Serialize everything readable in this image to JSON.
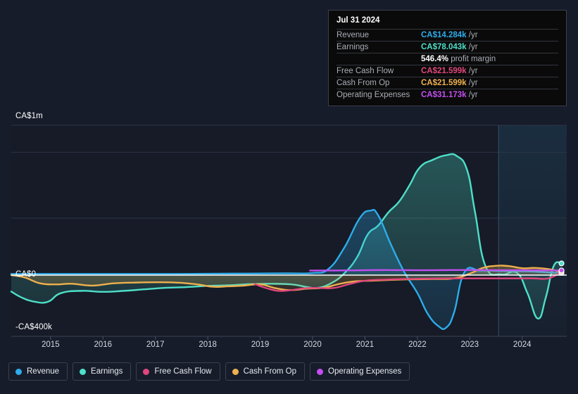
{
  "background_color": "#171c2a",
  "tooltip": {
    "date": "Jul 31 2024",
    "rows": [
      {
        "label": "Revenue",
        "value": "CA$14.284k",
        "unit": "/yr",
        "color": "#2dacea"
      },
      {
        "label": "Earnings",
        "value": "CA$78.043k",
        "unit": "/yr",
        "color": "#4edfc8"
      },
      {
        "label": "",
        "value": "546.4%",
        "unit": "profit margin",
        "color": "#ffffff",
        "is_margin": true
      },
      {
        "label": "Free Cash Flow",
        "value": "CA$21.599k",
        "unit": "/yr",
        "color": "#e0467c"
      },
      {
        "label": "Cash From Op",
        "value": "CA$21.599k",
        "unit": "/yr",
        "color": "#eeb04e"
      },
      {
        "label": "Operating Expenses",
        "value": "CA$31.173k",
        "unit": "/yr",
        "color": "#c24ef0"
      }
    ]
  },
  "legend": {
    "items": [
      {
        "label": "Revenue",
        "color": "#2dacea"
      },
      {
        "label": "Earnings",
        "color": "#4edfc8"
      },
      {
        "label": "Free Cash Flow",
        "color": "#e0467c"
      },
      {
        "label": "Cash From Op",
        "color": "#eeb04e"
      },
      {
        "label": "Operating Expenses",
        "color": "#c24ef0"
      }
    ]
  },
  "chart_data": {
    "type": "line",
    "title": "",
    "xlabel": "",
    "ylabel": "",
    "currency": "CA$",
    "grid": true,
    "legend_position": "bottom",
    "y_axis": {
      "labels": [
        "CA$1m",
        "CA$0",
        "-CA$400k"
      ],
      "values": [
        1000000,
        0,
        -400000
      ],
      "ylim": [
        -400000,
        1000000
      ],
      "gridlines": [
        1000000,
        820000,
        380000,
        0
      ]
    },
    "x_axis": {
      "tick_labels": [
        "2015",
        "2016",
        "2017",
        "2018",
        "2019",
        "2020",
        "2021",
        "2022",
        "2023",
        "2024"
      ],
      "tick_values": [
        2015,
        2016,
        2017,
        2018,
        2019,
        2020,
        2021,
        2022,
        2023,
        2024
      ],
      "xlim": [
        2014.25,
        2024.85
      ]
    },
    "forecast_band": {
      "start": 2023.55,
      "end": 2024.85,
      "label": ""
    },
    "series": [
      {
        "name": "Revenue",
        "color": "#2dacea",
        "x": [
          2014.25,
          2014.6,
          2015.0,
          2015.5,
          2016.0,
          2016.5,
          2017.0,
          2017.5,
          2018.0,
          2018.5,
          2019.0,
          2019.5,
          2020.0,
          2020.3,
          2020.6,
          2020.9,
          2021.1,
          2021.25,
          2021.5,
          2021.75,
          2022.0,
          2022.2,
          2022.4,
          2022.55,
          2022.7,
          2022.9,
          2023.2,
          2023.55,
          2023.9,
          2024.2,
          2024.5,
          2024.75
        ],
        "values": [
          8000,
          8000,
          8000,
          8000,
          8000,
          8000,
          8000,
          8000,
          9000,
          10000,
          11000,
          12000,
          14000,
          40000,
          180000,
          380000,
          430000,
          400000,
          200000,
          20000,
          -120000,
          -260000,
          -340000,
          -350000,
          -250000,
          20000,
          30000,
          28000,
          26000,
          24000,
          18000,
          14284
        ]
      },
      {
        "name": "Earnings",
        "color": "#4edfc8",
        "x": [
          2014.25,
          2014.45,
          2014.7,
          2014.95,
          2015.2,
          2015.6,
          2016.0,
          2016.4,
          2016.8,
          2017.2,
          2017.6,
          2018.0,
          2018.4,
          2018.8,
          2019.2,
          2019.6,
          2019.9,
          2020.1,
          2020.35,
          2020.6,
          2020.85,
          2021.05,
          2021.25,
          2021.45,
          2021.65,
          2021.85,
          2022.05,
          2022.3,
          2022.55,
          2022.75,
          2022.95,
          2023.1,
          2023.3,
          2023.6,
          2023.9,
          2024.1,
          2024.3,
          2024.45,
          2024.6,
          2024.75
        ],
        "values": [
          -110000,
          -150000,
          -178000,
          -178000,
          -120000,
          -105000,
          -112000,
          -105000,
          -95000,
          -85000,
          -80000,
          -72000,
          -68000,
          -60000,
          -58000,
          -62000,
          -80000,
          -85000,
          -55000,
          10000,
          120000,
          270000,
          330000,
          420000,
          490000,
          600000,
          720000,
          770000,
          800000,
          795000,
          700000,
          420000,
          60000,
          5000,
          15000,
          -120000,
          -290000,
          -150000,
          60000,
          78043
        ]
      },
      {
        "name": "Free Cash Flow",
        "color": "#e0467c",
        "x": [
          2018.9,
          2019.1,
          2019.35,
          2019.6,
          2019.85,
          2020.1,
          2020.4,
          2020.7,
          2021.0,
          2021.4,
          2021.8,
          2022.2,
          2022.6,
          2023.0,
          2023.4,
          2023.8,
          2024.2,
          2024.5,
          2024.75
        ],
        "values": [
          -60000,
          -85000,
          -105000,
          -100000,
          -88000,
          -86000,
          -86000,
          -60000,
          -38000,
          -30000,
          -26000,
          -24000,
          -22000,
          -22000,
          -22000,
          -21800,
          -21700,
          -21650,
          21599
        ]
      },
      {
        "name": "Cash From Op",
        "color": "#eeb04e",
        "x": [
          2014.25,
          2014.5,
          2014.8,
          2015.1,
          2015.4,
          2015.8,
          2016.2,
          2016.6,
          2017.0,
          2017.4,
          2017.8,
          2018.1,
          2018.4,
          2018.7,
          2019.0,
          2019.3,
          2019.6,
          2019.9,
          2020.2,
          2020.5,
          2020.8,
          2021.1,
          2021.5,
          2021.9,
          2022.3,
          2022.7,
          2023.0,
          2023.25,
          2023.5,
          2023.75,
          2024.0,
          2024.25,
          2024.5,
          2024.75
        ],
        "values": [
          0,
          -15000,
          -55000,
          -62000,
          -58000,
          -70000,
          -55000,
          -50000,
          -48000,
          -50000,
          -62000,
          -78000,
          -75000,
          -70000,
          -62000,
          -88000,
          -100000,
          -90000,
          -85000,
          -60000,
          -42000,
          -38000,
          -32000,
          -28000,
          -26000,
          -22000,
          10000,
          48000,
          62000,
          60000,
          46000,
          48000,
          40000,
          21599
        ]
      },
      {
        "name": "Operating Expenses",
        "color": "#c24ef0",
        "x": [
          2019.95,
          2020.2,
          2020.5,
          2020.8,
          2021.1,
          2021.4,
          2021.8,
          2022.2,
          2022.6,
          2023.0,
          2023.4,
          2023.8,
          2024.2,
          2024.5,
          2024.75
        ],
        "values": [
          30000,
          30500,
          31000,
          31500,
          33000,
          33500,
          33000,
          32500,
          33500,
          34000,
          33000,
          32500,
          32000,
          31500,
          31173
        ]
      }
    ]
  }
}
